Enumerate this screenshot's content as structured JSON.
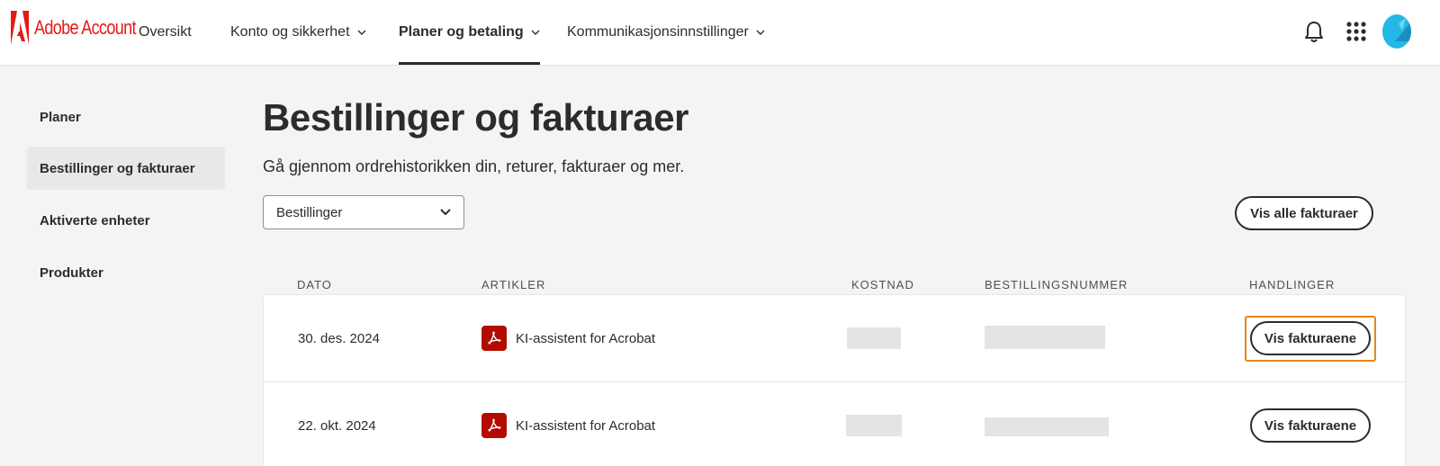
{
  "header": {
    "brand": "Adobe Account",
    "nav": [
      {
        "label": "Oversikt",
        "active": false,
        "dropdown": false
      },
      {
        "label": "Konto og sikkerhet",
        "active": false,
        "dropdown": true
      },
      {
        "label": "Planer og betaling",
        "active": true,
        "dropdown": true
      },
      {
        "label": "Kommunikasjonsinnstillinger",
        "active": false,
        "dropdown": true
      }
    ],
    "icons": [
      "bell-icon",
      "app-grid-icon",
      "avatar"
    ]
  },
  "sidebar": {
    "items": [
      {
        "label": "Planer",
        "selected": false
      },
      {
        "label": "Bestillinger og fakturaer",
        "selected": true
      },
      {
        "label": "Aktiverte enheter",
        "selected": false
      },
      {
        "label": "Produkter",
        "selected": false
      }
    ]
  },
  "main": {
    "title": "Bestillinger og fakturaer",
    "subtitle": "Gå gjennom ordrehistorikken din, returer, fakturaer og mer.",
    "filter": {
      "selected": "Bestillinger"
    },
    "view_all_label": "Vis alle fakturaer",
    "table": {
      "columns": [
        "DATO",
        "ARTIKLER",
        "KOSTNAD",
        "BESTILLINGSNUMMER",
        "HANDLINGER"
      ],
      "rows": [
        {
          "date": "30. des. 2024",
          "item": "KI-assistent for Acrobat",
          "cost": "",
          "order_number": "",
          "action": "Vis fakturaene",
          "focused": true
        },
        {
          "date": "22. okt. 2024",
          "item": "KI-assistent for Acrobat",
          "cost": "",
          "order_number": "",
          "action": "Vis fakturaene",
          "focused": false
        }
      ]
    }
  },
  "colors": {
    "brand_red": "#e21b16",
    "pdf_red": "#b30b00",
    "focus_orange": "#e68619",
    "background": "#f4f4f4",
    "avatar_blue": "#24b8e6"
  }
}
